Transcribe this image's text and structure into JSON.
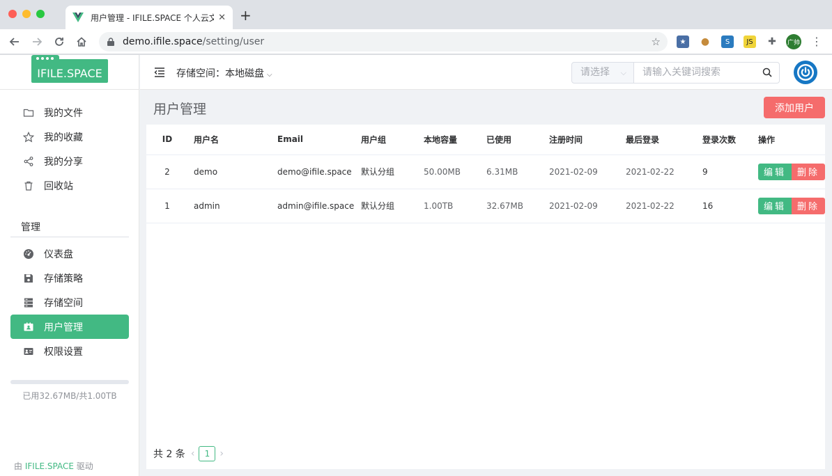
{
  "browser": {
    "tab_title": "用户管理 - IFILE.SPACE 个人云文件",
    "tab_close": "✕",
    "new_tab": "+",
    "url_host": "demo.ifile.space",
    "url_path": "/setting/user",
    "avatar_text": "广帅"
  },
  "sidebar": {
    "logo_text": "IFILE.SPACE",
    "items": [
      {
        "label": "我的文件",
        "icon": "folder-icon"
      },
      {
        "label": "我的收藏",
        "icon": "star-icon"
      },
      {
        "label": "我的分享",
        "icon": "share-icon"
      },
      {
        "label": "回收站",
        "icon": "trash-icon"
      }
    ],
    "admin_title": "管理",
    "admin_items": [
      {
        "label": "仪表盘",
        "icon": "dashboard-icon"
      },
      {
        "label": "存储策略",
        "icon": "save-icon"
      },
      {
        "label": "存储空间",
        "icon": "server-icon"
      },
      {
        "label": "用户管理",
        "icon": "user-card-icon",
        "active": true
      },
      {
        "label": "权限设置",
        "icon": "id-card-icon"
      }
    ],
    "usage_text": "已用32.67MB/共1.00TB",
    "usage_fraction": 3.19e-05,
    "powered_prefix": "由",
    "powered_brand": "IFILE.SPACE",
    "powered_suffix": "驱动"
  },
  "header": {
    "storage_label": "存储空间：",
    "storage_value": "本地磁盘",
    "search_select_placeholder": "请选择",
    "search_placeholder": "请输入关键词搜索"
  },
  "main": {
    "title": "用户管理",
    "add_button": "添加用户",
    "columns": [
      "ID",
      "用户名",
      "Email",
      "用户组",
      "本地容量",
      "已使用",
      "注册时间",
      "最后登录",
      "登录次数",
      "操作"
    ],
    "rows": [
      {
        "id": "2",
        "username": "demo",
        "email": "demo@ifile.space",
        "group": "默认分组",
        "capacity": "50.00MB",
        "used": "6.31MB",
        "registered": "2021-02-09",
        "last_login": "2021-02-22",
        "count": "9"
      },
      {
        "id": "1",
        "username": "admin",
        "email": "admin@ifile.space",
        "group": "默认分组",
        "capacity": "1.00TB",
        "used": "32.67MB",
        "registered": "2021-02-09",
        "last_login": "2021-02-22",
        "count": "16"
      }
    ],
    "edit_label": "编辑",
    "delete_label": "删除",
    "pager_total": "共 2 条",
    "pager_current": "1"
  },
  "colors": {
    "accent": "#42b983",
    "danger": "#f56c6c",
    "power": "#1677c4"
  }
}
